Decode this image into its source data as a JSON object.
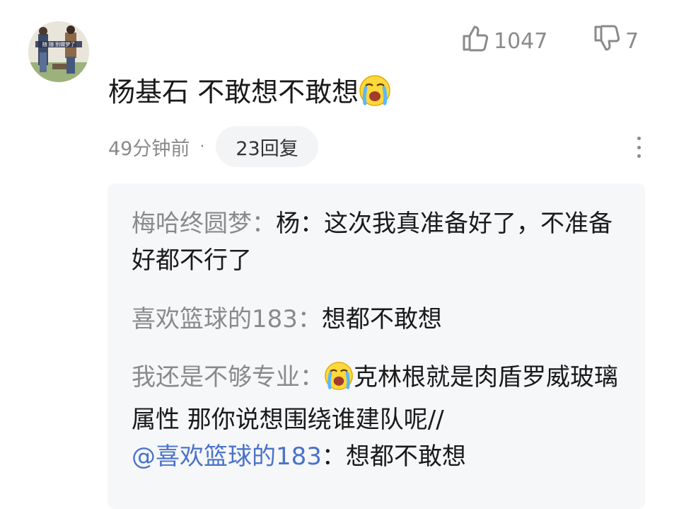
{
  "comment": {
    "text": "杨基石 不敢想不敢想",
    "time": "49分钟前",
    "dot": "·",
    "reply_count": "23回复",
    "likes": "1047",
    "dislikes": "7",
    "avatar_caption": "随 随 别做梦了"
  },
  "replies": [
    {
      "author": "梅哈终圆梦",
      "sep": "：",
      "text": "杨：这次我真准备好了，不准备好都不行了"
    },
    {
      "author": "喜欢篮球的183",
      "sep": "：",
      "text": "想都不敢想"
    },
    {
      "author": "我还是不够专业",
      "sep": "：",
      "text_before_emoji": "",
      "text": "克林根就是肉盾罗威玻璃属性 那你说想围绕谁建队呢//",
      "mention": "@喜欢篮球的183",
      "mention_sep": "：",
      "mention_text": "想都不敢想"
    }
  ],
  "icons": {
    "like": "thumbs-up-icon",
    "dislike": "thumbs-down-icon",
    "emoji": "crying-face-emoji",
    "more": "more-vertical-icon"
  },
  "colors": {
    "author": "#8a8a8a",
    "mention": "#4a73c9",
    "reply_bg": "#f6f7f9"
  }
}
